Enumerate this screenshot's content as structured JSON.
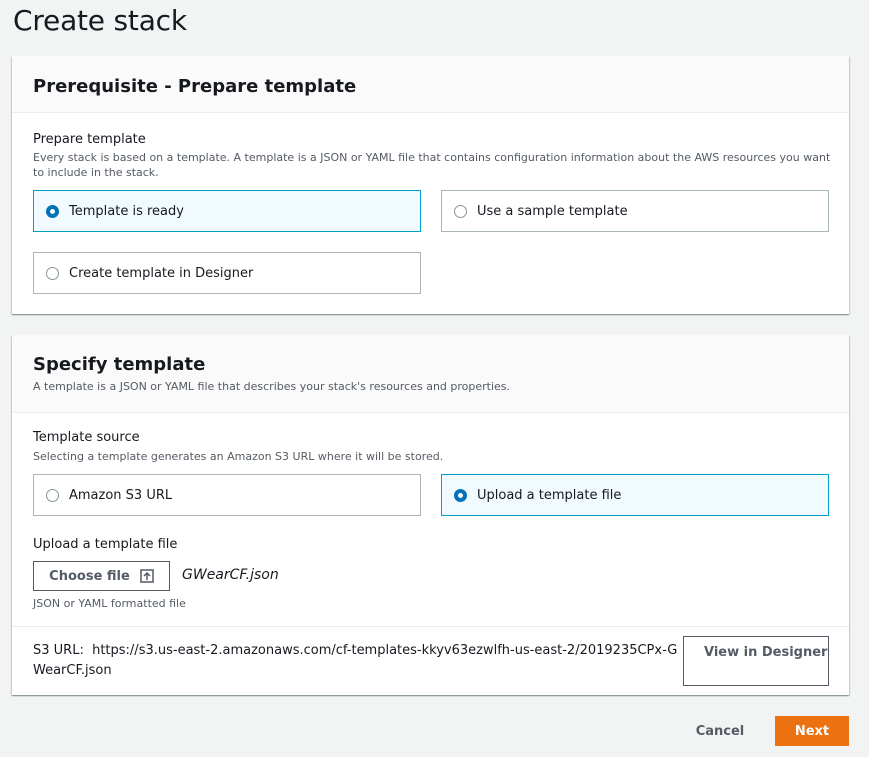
{
  "page": {
    "title": "Create stack"
  },
  "prerequisite": {
    "title": "Prerequisite - Prepare template",
    "field_label": "Prepare template",
    "field_desc": "Every stack is based on a template. A template is a JSON or YAML file that contains configuration information about the AWS resources you want to include in the stack.",
    "options": [
      {
        "label": "Template is ready",
        "selected": true
      },
      {
        "label": "Use a sample template",
        "selected": false
      },
      {
        "label": "Create template in Designer",
        "selected": false
      }
    ]
  },
  "specify": {
    "title": "Specify template",
    "desc": "A template is a JSON or YAML file that describes your stack's resources and properties.",
    "source_label": "Template source",
    "source_desc": "Selecting a template generates an Amazon S3 URL where it will be stored.",
    "options": [
      {
        "label": "Amazon S3 URL",
        "selected": false
      },
      {
        "label": "Upload a template file",
        "selected": true
      }
    ],
    "upload_label": "Upload a template file",
    "choose_file_label": "Choose file",
    "file_name": "GWearCF.json",
    "upload_hint": "JSON or YAML formatted file",
    "s3_url_label": "S3 URL:",
    "s3_url_value": "https://s3.us-east-2.amazonaws.com/cf-templates-kkyv63ezwlfh-us-east-2/2019235CPx-GWearCF.json",
    "view_designer_label": "View in Designer"
  },
  "footer": {
    "cancel_label": "Cancel",
    "next_label": "Next"
  },
  "colors": {
    "primary": "#ec7211",
    "selected_border": "#00a1c9",
    "selected_bg": "#f1faff",
    "radio_on": "#0073bb"
  }
}
